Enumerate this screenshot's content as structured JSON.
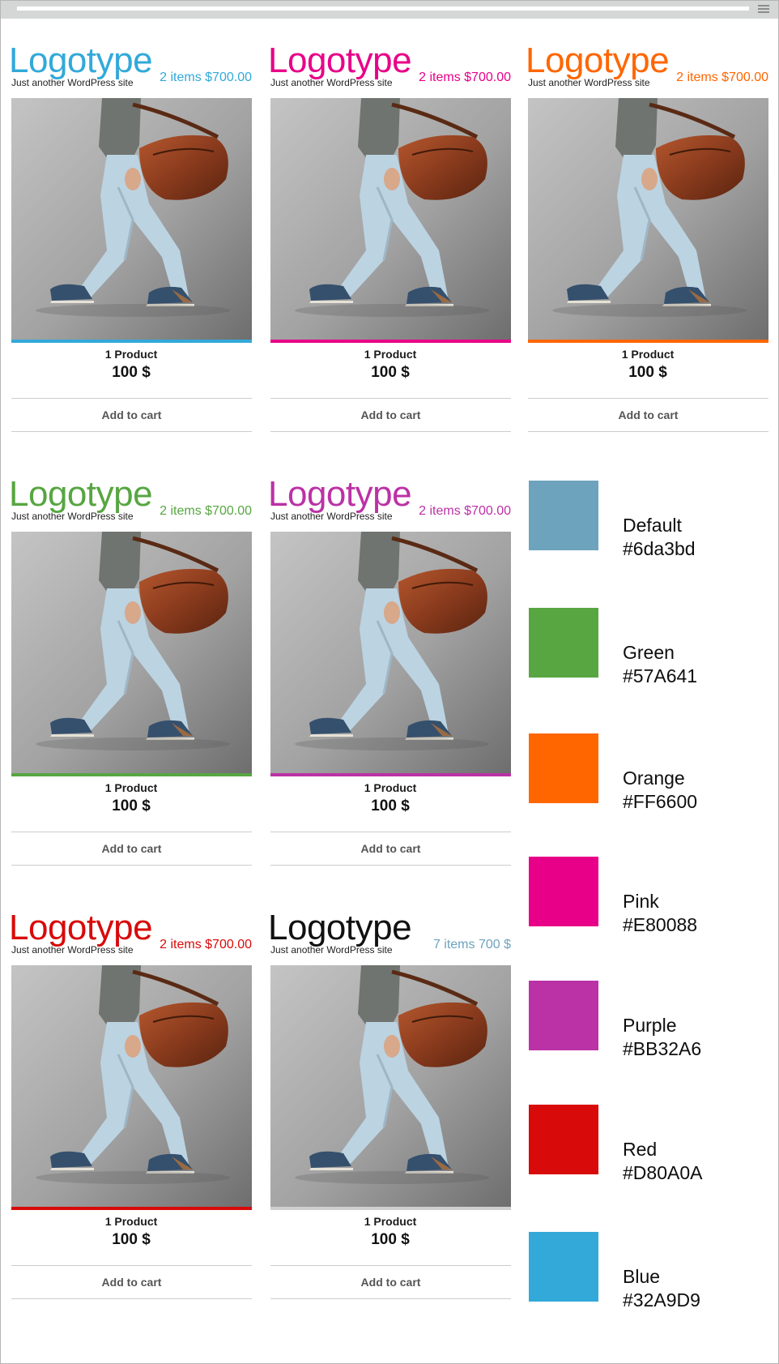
{
  "cards": [
    {
      "logo": "Logotype",
      "tagline": "Just another WordPress site",
      "cart": "2 items $700.00",
      "product": "1 Product",
      "price": "100 $",
      "button": "Add to cart",
      "accent": "#32A9D9"
    },
    {
      "logo": "Logotype",
      "tagline": "Just another WordPress site",
      "cart": "2 items $700.00",
      "product": "1 Product",
      "price": "100 $",
      "button": "Add to cart",
      "accent": "#E80088"
    },
    {
      "logo": "Logotype",
      "tagline": "Just another WordPress site",
      "cart": "2 items $700.00",
      "product": "1 Product",
      "price": "100 $",
      "button": "Add to cart",
      "accent": "#FF6600"
    },
    {
      "logo": "Logotype",
      "tagline": "Just another WordPress site",
      "cart": "2 items $700.00",
      "product": "1 Product",
      "price": "100 $",
      "button": "Add to cart",
      "accent": "#57A641"
    },
    {
      "logo": "Logotype",
      "tagline": "Just another WordPress site",
      "cart": "2 items $700.00",
      "product": "1 Product",
      "price": "100 $",
      "button": "Add to cart",
      "accent": "#BB32A6"
    },
    {
      "logo": "Logotype",
      "tagline": "Just another WordPress site",
      "cart": "2 items $700.00",
      "product": "1 Product",
      "price": "100 $",
      "button": "Add to cart",
      "accent": "#D80A0A"
    },
    {
      "logo": "Logotype",
      "tagline": "Just another WordPress site",
      "cart": "7 items 700 $",
      "product": "1 Product",
      "price": "100 $",
      "button": "Add to cart",
      "accent": "#6da3bd",
      "logo_color": "#111111",
      "bar_color": "#cfcfcf"
    }
  ],
  "swatches": [
    {
      "name": "Default",
      "hex": "#6da3bd",
      "color": "#6da3bd"
    },
    {
      "name": "Green",
      "hex": "#57A641",
      "color": "#57A641"
    },
    {
      "name": "Orange",
      "hex": "#FF6600",
      "color": "#FF6600"
    },
    {
      "name": "Pink",
      "hex": "#E80088",
      "color": "#E80088"
    },
    {
      "name": "Purple",
      "hex": "#BB32A6",
      "color": "#BB32A6"
    },
    {
      "name": "Red",
      "hex": "#D80A0A",
      "color": "#D80A0A"
    },
    {
      "name": "Blue",
      "hex": "#32A9D9",
      "color": "#32A9D9"
    }
  ]
}
